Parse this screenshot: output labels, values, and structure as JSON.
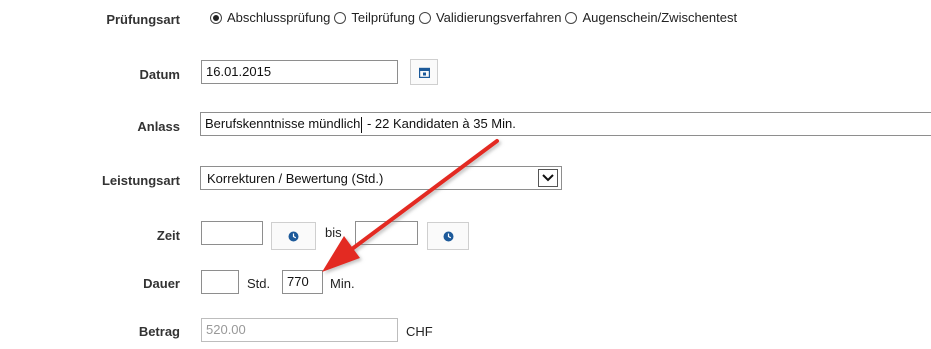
{
  "form": {
    "pruefungsart": {
      "label": "Prüfungsart",
      "options": [
        {
          "label": "Abschlussprüfung",
          "checked": true
        },
        {
          "label": "Teilprüfung",
          "checked": false
        },
        {
          "label": "Validierungsverfahren",
          "checked": false
        },
        {
          "label": "Augenschein/Zwischentest",
          "checked": false
        }
      ]
    },
    "datum": {
      "label": "Datum",
      "value": "16.01.2015",
      "icon": "calendar-icon"
    },
    "anlass": {
      "label": "Anlass",
      "value_before_cursor": "Berufskenntnisse mündlich",
      "value_after_cursor": " - 22 Kandidaten à 35 Min."
    },
    "leistungsart": {
      "label": "Leistungsart",
      "selected": "Korrekturen / Bewertung (Std.)"
    },
    "zeit": {
      "label": "Zeit",
      "from_value": "",
      "separator": "bis",
      "to_value": "",
      "icon": "clock-icon"
    },
    "dauer": {
      "label": "Dauer",
      "hours_value": "",
      "hours_unit": "Std.",
      "minutes_value": "770",
      "minutes_unit": "Min."
    },
    "betrag": {
      "label": "Betrag",
      "value": "520.00",
      "currency": "CHF"
    }
  },
  "colors": {
    "icon_blue": "#1d5a9a",
    "annotation_arrow": "#e32b22"
  }
}
